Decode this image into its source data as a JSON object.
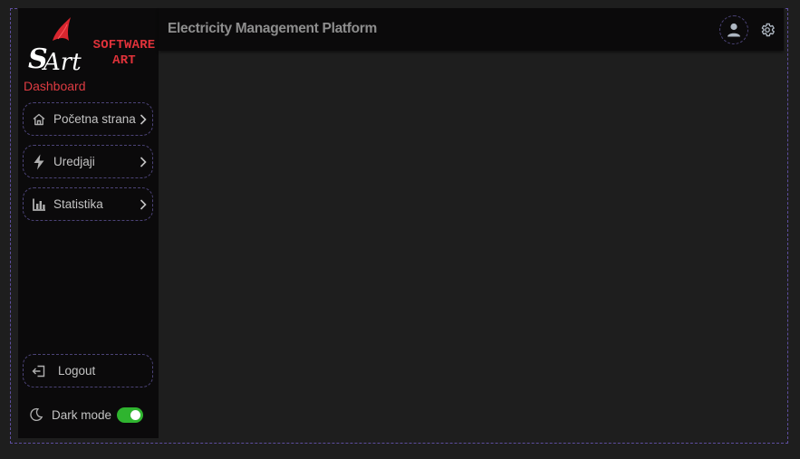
{
  "header": {
    "title": "Electricity Management Platform",
    "avatar_icon": "account-icon",
    "settings_icon": "gear-icon"
  },
  "brand": {
    "logo_line1": "SOFTWARE",
    "logo_line2": "ART",
    "logo_mark": "SArt",
    "accent_color": "#e0323a"
  },
  "sidebar": {
    "section_label": "Dashboard",
    "items": [
      {
        "label": "Početna strana",
        "icon": "home-icon"
      },
      {
        "label": "Uredjaji",
        "icon": "bolt-icon"
      },
      {
        "label": "Statistika",
        "icon": "bar-chart-icon"
      }
    ],
    "logout": {
      "label": "Logout",
      "icon": "logout-icon"
    },
    "dark_mode": {
      "label": "Dark mode",
      "icon": "moon-icon",
      "enabled": true,
      "color": "#2fb42f"
    }
  }
}
